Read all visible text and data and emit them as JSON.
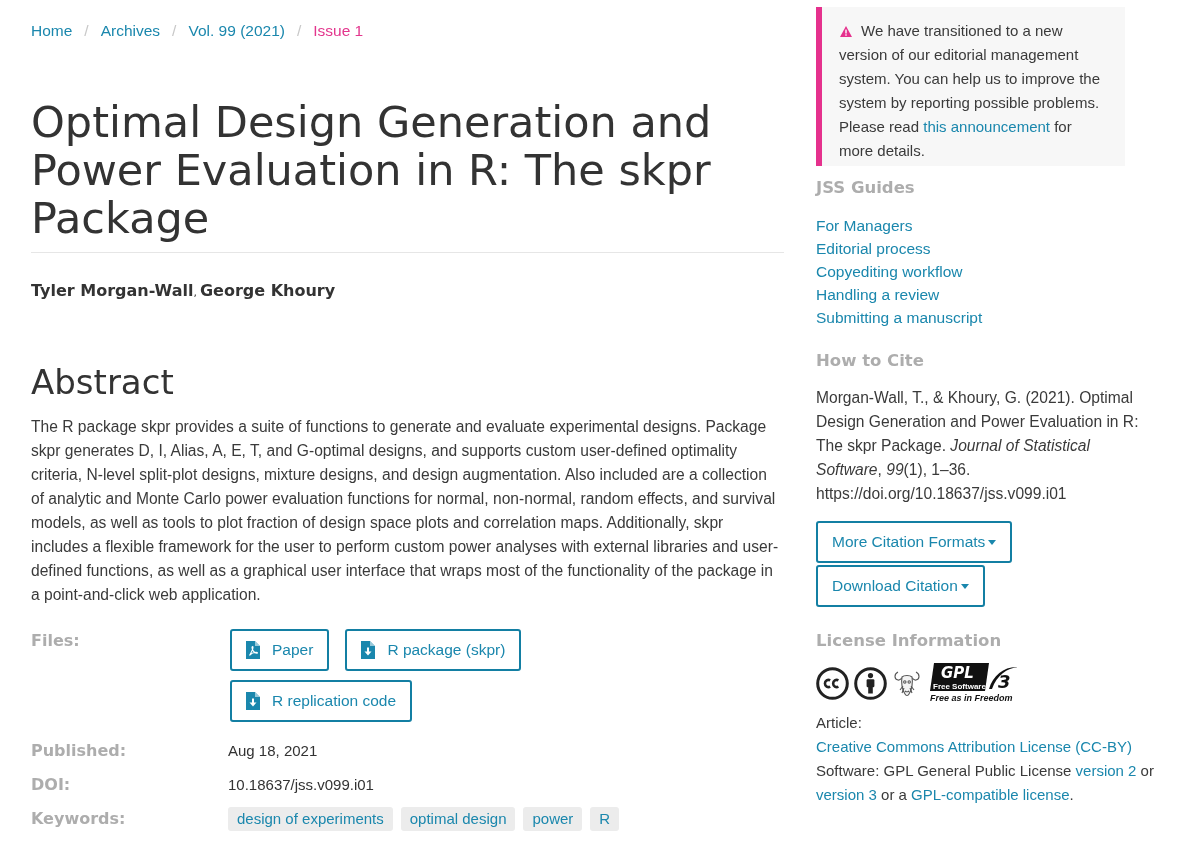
{
  "breadcrumb": [
    {
      "label": "Home",
      "selected": false,
      "separator": "/"
    },
    {
      "label": "Archives",
      "selected": false,
      "separator": "/"
    },
    {
      "label": "Vol. 99 (2021)",
      "selected": false,
      "separator": "/"
    },
    {
      "label": "Issue 1",
      "selected": true
    }
  ],
  "article": {
    "title": "Optimal Design Generation and Power Evaluation in R: The skpr Package",
    "authors": [
      {
        "name": "Tyler Morgan-Wall",
        "separator": ","
      },
      {
        "name": "George Khoury"
      }
    ],
    "abstract_heading": "Abstract",
    "abstract": "The R package skpr provides a suite of functions to generate and evaluate experimental designs. Package skpr generates D, I, Alias, A, E, T, and G-optimal designs, and supports custom user-defined optimality criteria, N-level split-plot designs, mixture designs, and design augmentation. Also included are a collection of analytic and Monte Carlo power evaluation functions for normal, non-normal, random effects, and survival models, as well as tools to plot fraction of design space plots and correlation maps. Additionally, skpr includes a flexible framework for the user to perform custom power analyses with external libraries and user-defined functions, as well as a graphical user interface that wraps most of the functionality of the package in a point-and-click web application.",
    "details": [
      {
        "kind": "files",
        "label": "Files:",
        "files": [
          {
            "kind": "pdf",
            "label": "Paper"
          },
          {
            "kind": "download",
            "label": "R package (skpr)"
          },
          {
            "kind": "download",
            "label": "R replication code"
          }
        ]
      },
      {
        "kind": "text",
        "label": "Published:",
        "value": "Aug 18, 2021"
      },
      {
        "kind": "link",
        "label": "DOI:",
        "value": "10.18637/jss.v099.i01"
      },
      {
        "kind": "tags",
        "label": "Keywords:",
        "tags": [
          "design of experiments",
          "optimal design",
          "power",
          "R"
        ]
      }
    ]
  },
  "sidebar": {
    "notice": {
      "text": "We have transitioned to a new version of our editorial management system. You can help us to improve the system by reporting possible problems. Please read ",
      "link": "this announcement",
      "text_after": " for more details."
    },
    "guides": {
      "heading": "JSS Guides",
      "links": [
        "For Managers",
        "Editorial process",
        "Copyediting workflow",
        "Handling a review",
        "Submitting a manuscript"
      ]
    },
    "citation": {
      "heading": "How to Cite",
      "text": "Morgan-Wall, T., & Khoury, G. (2021). Optimal Design Generation and Power Evaluation in R: The skpr Package. *Journal of Statistical Software*, *99*(1), 1–36. https://doi.org/10.18637/jss.v099.i01",
      "buttons": [
        "More Citation Formats",
        "Download Citation"
      ]
    },
    "license": {
      "heading": "License Information",
      "badges": [
        {
          "kind": "cc"
        },
        {
          "kind": "by"
        },
        {
          "kind": "gnu"
        },
        {
          "kind": "gplv3",
          "mark": "GPL",
          "version": "3",
          "tagline": "Free Software",
          "motto": "Free as in Freedom"
        }
      ],
      "lines": [
        [
          {
            "kind": "text",
            "text": "Article: "
          },
          {
            "kind": "link",
            "text": "Creative Commons Attribution License (CC-BY)"
          }
        ],
        [
          {
            "kind": "text",
            "text": "Software: GPL General Public License "
          },
          {
            "kind": "link",
            "text": "version 2"
          },
          {
            "kind": "text",
            "text": " or "
          },
          {
            "kind": "link",
            "text": "version 3"
          },
          {
            "kind": "text",
            "text": " or a "
          },
          {
            "kind": "link",
            "text": "GPL-compatible license"
          },
          {
            "kind": "text",
            "text": "."
          }
        ]
      ]
    }
  }
}
